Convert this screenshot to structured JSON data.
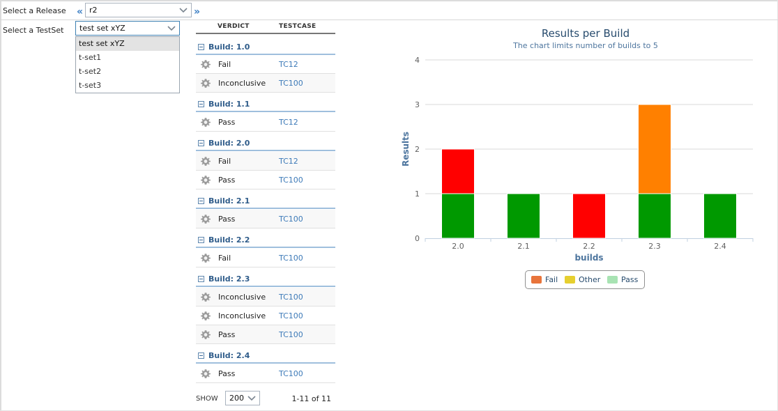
{
  "release": {
    "label": "Select a Release",
    "value": "r2",
    "prev_icon": "«",
    "next_icon": "»"
  },
  "testset": {
    "label": "Select a TestSet",
    "value": "test set xYZ",
    "options": [
      "test set xYZ",
      "t-set1",
      "t-set2",
      "t-set3"
    ]
  },
  "grid": {
    "columns": {
      "verdict": "VERDICT",
      "testcase": "TESTCASE"
    },
    "groups": [
      {
        "title": "Build: 1.0",
        "rows": [
          {
            "verdict": "Fail",
            "testcase": "TC12"
          },
          {
            "verdict": "Inconclusive",
            "testcase": "TC100"
          }
        ]
      },
      {
        "title": "Build: 1.1",
        "rows": [
          {
            "verdict": "Pass",
            "testcase": "TC12"
          }
        ]
      },
      {
        "title": "Build: 2.0",
        "rows": [
          {
            "verdict": "Fail",
            "testcase": "TC12"
          },
          {
            "verdict": "Pass",
            "testcase": "TC100"
          }
        ]
      },
      {
        "title": "Build: 2.1",
        "rows": [
          {
            "verdict": "Pass",
            "testcase": "TC100"
          }
        ]
      },
      {
        "title": "Build: 2.2",
        "rows": [
          {
            "verdict": "Fail",
            "testcase": "TC100"
          }
        ]
      },
      {
        "title": "Build: 2.3",
        "rows": [
          {
            "verdict": "Inconclusive",
            "testcase": "TC100"
          },
          {
            "verdict": "Inconclusive",
            "testcase": "TC100"
          },
          {
            "verdict": "Pass",
            "testcase": "TC100"
          }
        ]
      },
      {
        "title": "Build: 2.4",
        "rows": [
          {
            "verdict": "Pass",
            "testcase": "TC100"
          }
        ]
      }
    ]
  },
  "pager": {
    "show_label": "SHOW",
    "page_size": "200",
    "info": "1-11 of 11"
  },
  "icons": {
    "row_action": "gear-icon",
    "group_toggle": "collapse-icon",
    "dropdown": "chevron-down-icon"
  },
  "colors": {
    "fail_bar": "#ff0000",
    "inconclusive_bar": "#ff8000",
    "pass_bar": "#009900",
    "legend_fail": "#e8743b",
    "legend_other": "#e6cf2f",
    "legend_pass": "#a8e3b3",
    "link": "#3d7ab8",
    "title": "#274b6d"
  },
  "chart_data": {
    "type": "bar",
    "stacked": true,
    "title": "Results per Build",
    "subtitle": "The chart limits number of builds to 5",
    "xlabel": "builds",
    "ylabel": "Results",
    "ylim": [
      0,
      4
    ],
    "yticks": [
      0,
      1,
      2,
      3,
      4
    ],
    "grid": true,
    "legend_placement": "bottom-center",
    "categories": [
      "2.0",
      "2.1",
      "2.2",
      "2.3",
      "2.4"
    ],
    "stacks": [
      [
        {
          "value": 1,
          "color": "#009900"
        },
        {
          "value": 1,
          "color": "#ff0000"
        }
      ],
      [
        {
          "value": 1,
          "color": "#009900"
        }
      ],
      [
        {
          "value": 1,
          "color": "#ff0000"
        }
      ],
      [
        {
          "value": 1,
          "color": "#009900"
        },
        {
          "value": 2,
          "color": "#ff8000"
        }
      ],
      [
        {
          "value": 1,
          "color": "#009900"
        }
      ]
    ],
    "legend": [
      {
        "name": "Fail",
        "color": "#e8743b"
      },
      {
        "name": "Other",
        "color": "#e6cf2f"
      },
      {
        "name": "Pass",
        "color": "#a8e3b3"
      }
    ]
  }
}
